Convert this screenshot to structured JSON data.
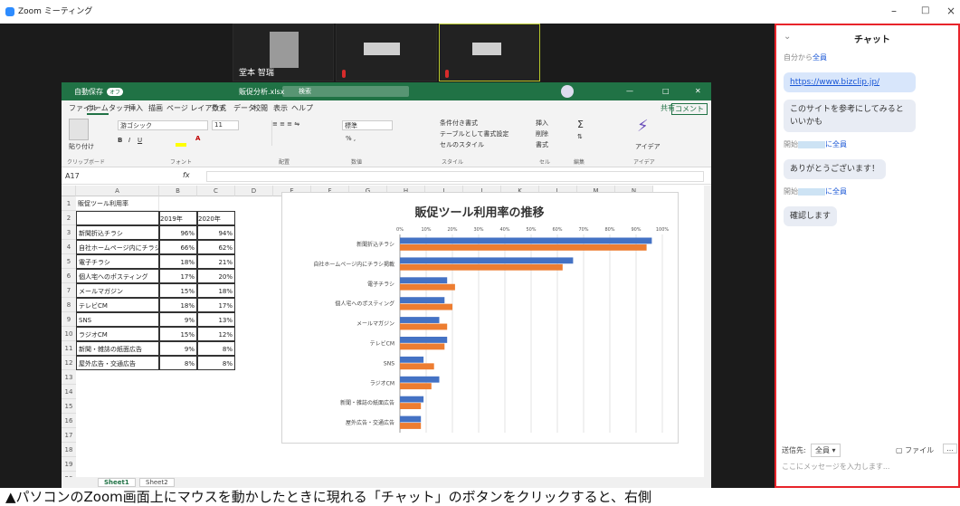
{
  "window": {
    "app_title": "Zoom ミーティング",
    "minimize": "–",
    "maximize": "□",
    "close": "×"
  },
  "gallery": {
    "user_name": "堂本 智瑞"
  },
  "excel": {
    "autosave": "自動保存",
    "autosave_state": "オフ",
    "filename": "販促分析.xlsx",
    "search": "検索",
    "tabs": [
      "ファイル",
      "ホーム",
      "タッチ",
      "挿入",
      "描画",
      "ページ レイアウト",
      "数式",
      "データ",
      "校閲",
      "表示",
      "ヘルプ"
    ],
    "share": "共有",
    "comment": "コメント",
    "ribbon": {
      "paste": "貼り付け",
      "font": "游ゴシック",
      "size": "11",
      "number_format": "標準",
      "cond_format": "条件付き書式",
      "table_format": "テーブルとして書式設定",
      "cell_style": "セルのスタイル",
      "insert": "挿入",
      "delete": "削除",
      "format": "書式",
      "ideas": "アイデア"
    },
    "groups": [
      "クリップボード",
      "フォント",
      "配置",
      "数値",
      "スタイル",
      "セル",
      "編集",
      "アイデア"
    ],
    "namebox": "A17",
    "fx": "fx",
    "columns": [
      "A",
      "B",
      "C",
      "D",
      "E",
      "F",
      "G",
      "H",
      "I",
      "J",
      "K",
      "L",
      "M",
      "N"
    ],
    "rows": [
      "1",
      "2",
      "3",
      "4",
      "5",
      "6",
      "7",
      "8",
      "9",
      "10",
      "11",
      "12",
      "13",
      "14",
      "15",
      "16",
      "17",
      "18",
      "19",
      "20"
    ],
    "table_title": "販促ツール利用率",
    "headers": [
      "2019年",
      "2020年"
    ],
    "table": [
      {
        "name": "新聞折込チラシ",
        "y2019": "96%",
        "y2020": "94%"
      },
      {
        "name": "自社ホームページ内にチラシ掲載",
        "y2019": "66%",
        "y2020": "62%"
      },
      {
        "name": "電子チラシ",
        "y2019": "18%",
        "y2020": "21%"
      },
      {
        "name": "個人宅へのポスティング",
        "y2019": "17%",
        "y2020": "20%"
      },
      {
        "name": "メールマガジン",
        "y2019": "15%",
        "y2020": "18%"
      },
      {
        "name": "テレビCM",
        "y2019": "18%",
        "y2020": "17%"
      },
      {
        "name": "SNS",
        "y2019": "9%",
        "y2020": "13%"
      },
      {
        "name": "ラジオCM",
        "y2019": "15%",
        "y2020": "12%"
      },
      {
        "name": "新聞・雑誌の紙面広告",
        "y2019": "9%",
        "y2020": "8%"
      },
      {
        "name": "屋外広告・交通広告",
        "y2019": "8%",
        "y2020": "8%"
      }
    ],
    "sheet_tabs": [
      "Sheet1",
      "Sheet2"
    ]
  },
  "chart_data": {
    "type": "bar",
    "orientation": "horizontal",
    "title": "販促ツール利用率の推移",
    "categories": [
      "新聞折込チラシ",
      "自社ホームページ内にチラシ掲載",
      "電子チラシ",
      "個人宅へのポスティング",
      "メールマガジン",
      "テレビCM",
      "SNS",
      "ラジオCM",
      "新聞・雑誌の紙面広告",
      "屋外広告・交通広告"
    ],
    "series": [
      {
        "name": "2019年",
        "values": [
          96,
          66,
          18,
          17,
          15,
          18,
          9,
          15,
          9,
          8
        ],
        "color": "#4472c4"
      },
      {
        "name": "2020年",
        "values": [
          94,
          62,
          21,
          20,
          18,
          17,
          13,
          12,
          8,
          8
        ],
        "color": "#ed7d31"
      }
    ],
    "xlim": [
      0,
      100
    ],
    "ticks": [
      "0%",
      "10%",
      "20%",
      "30%",
      "40%",
      "50%",
      "60%",
      "70%",
      "80%",
      "90%",
      "100%"
    ],
    "grid": true
  },
  "chat": {
    "header": "チャット",
    "messages": [
      {
        "meta_from": "自分から",
        "meta_to": "全員",
        "text": "https://www.bizclip.jp/",
        "link": true
      },
      {
        "text": "このサイトを参考にしてみるといいかも"
      },
      {
        "meta_from": "開始",
        "meta_to": "に全員",
        "text": "ありがとうございます！"
      },
      {
        "meta_from": "開始",
        "meta_to": "に全員",
        "text": "確認します"
      }
    ],
    "send_to_label": "送信先:",
    "send_to_value": "全員",
    "file_label": "ファイル",
    "placeholder": "ここにメッセージを入力します..."
  },
  "caption": "▲パソコンのZoom画面上にマウスを動かしたときに現れる「チャット」のボタンをクリックすると、右側"
}
